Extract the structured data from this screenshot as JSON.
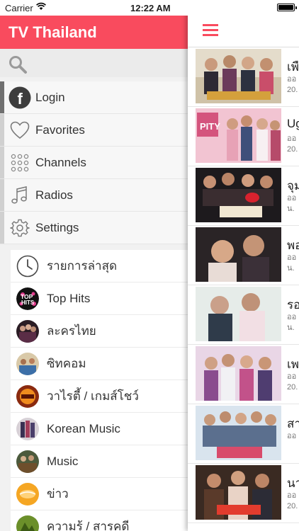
{
  "status_bar": {
    "carrier": "Carrier",
    "time": "12:22 AM"
  },
  "app": {
    "title": "TV Thailand"
  },
  "search": {
    "icon": "search-icon"
  },
  "menu": [
    {
      "label": "Login",
      "icon": "facebook-icon"
    },
    {
      "label": "Favorites",
      "icon": "heart-icon"
    },
    {
      "label": "Channels",
      "icon": "grid-icon"
    },
    {
      "label": "Radios",
      "icon": "music-note-icon"
    },
    {
      "label": "Settings",
      "icon": "gear-icon"
    }
  ],
  "categories": [
    {
      "label": "รายการล่าสุด",
      "icon": "clock-icon"
    },
    {
      "label": "Top Hits",
      "icon": "top-hits-icon"
    },
    {
      "label": "ละครไทย"
    },
    {
      "label": "ซิทคอม"
    },
    {
      "label": "วาไรตี้ / เกมส์โชว์"
    },
    {
      "label": "Korean Music"
    },
    {
      "label": "Music"
    },
    {
      "label": "ข่าว"
    },
    {
      "label": "ความรู้ / สารคดี"
    }
  ],
  "feed": [
    {
      "title": "เพื",
      "line1": "ออ",
      "line2": "20."
    },
    {
      "title": "Ug",
      "line1": "ออ",
      "line2": "20."
    },
    {
      "title": "จุม",
      "line1": "ออ",
      "line2": "น."
    },
    {
      "title": "พอ",
      "line1": "ออ",
      "line2": "น."
    },
    {
      "title": "รอ",
      "line1": "ออ",
      "line2": "น."
    },
    {
      "title": "เพ",
      "line1": "ออ",
      "line2": "20."
    },
    {
      "title": "สา",
      "line1": "ออ",
      "line2": ""
    },
    {
      "title": "นา",
      "line1": "ออ",
      "line2": "20."
    }
  ],
  "colors": {
    "accent": "#f94b5e",
    "drawer_bg": "#f1f1f1"
  }
}
